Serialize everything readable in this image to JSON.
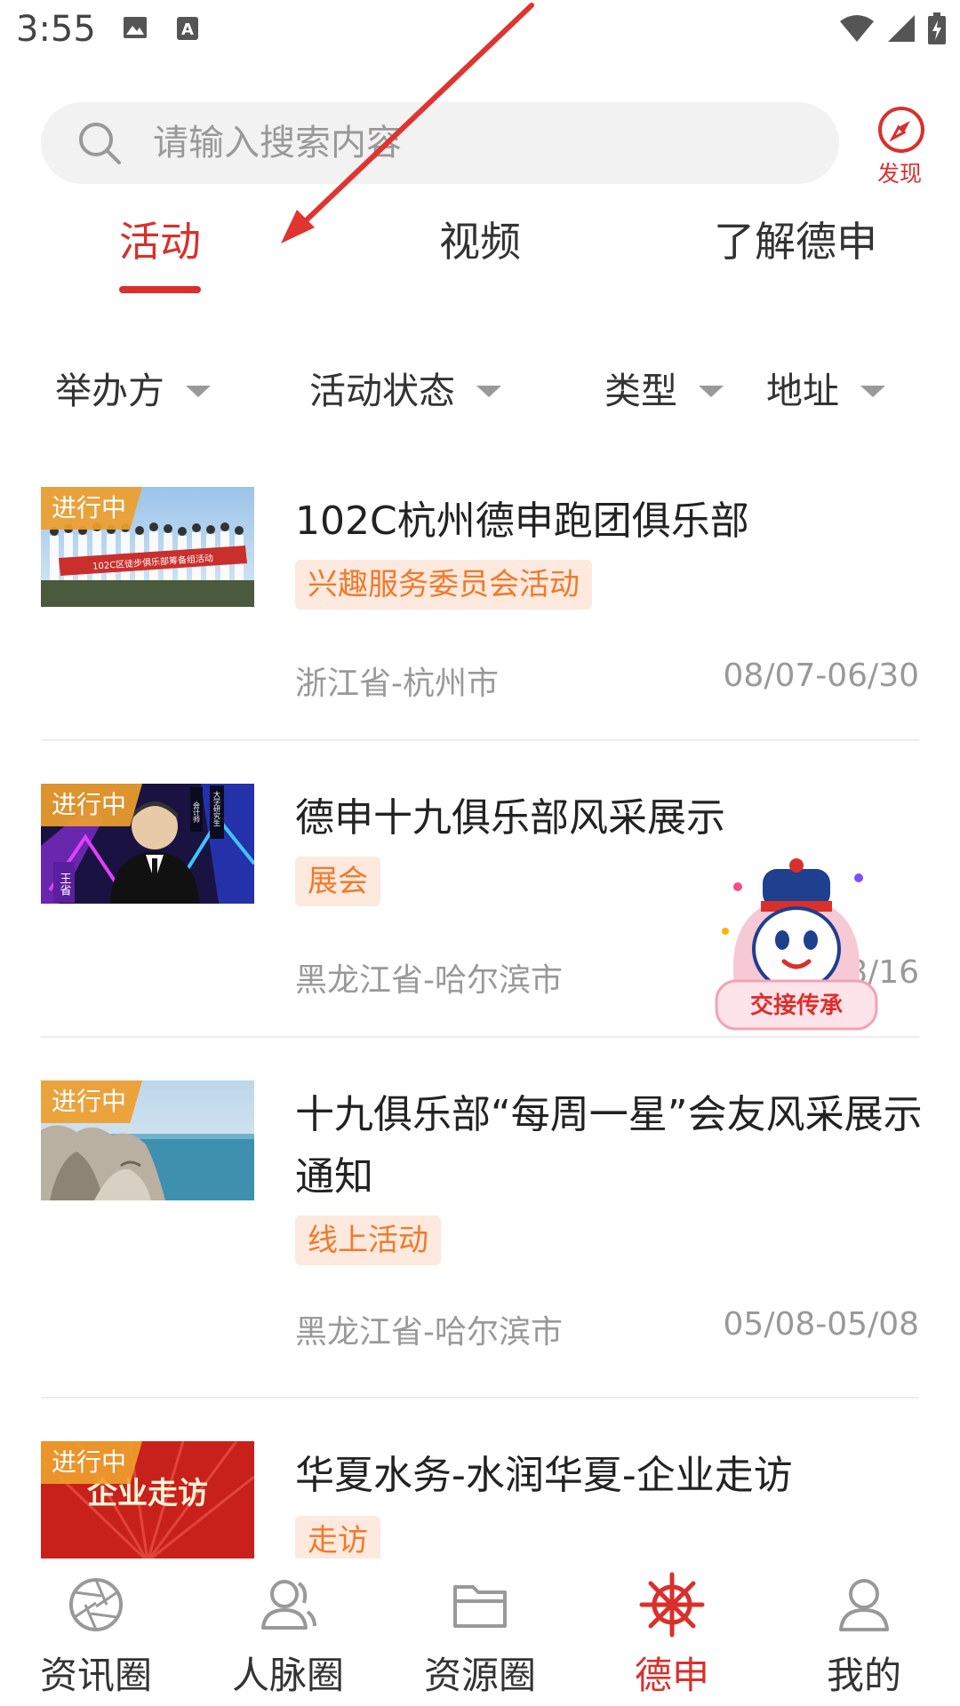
{
  "status_bar": {
    "time": "3:55",
    "left_icons": [
      "image-icon",
      "a-text-icon"
    ],
    "right_icons": [
      "wifi-icon",
      "signal-icon",
      "battery-charging-icon"
    ]
  },
  "search": {
    "placeholder": "请输入搜索内容",
    "discover_label": "发现"
  },
  "tabs": [
    {
      "label": "活动",
      "active": true
    },
    {
      "label": "视频",
      "active": false
    },
    {
      "label": "了解德申",
      "active": false
    }
  ],
  "filters": [
    {
      "label": "举办方"
    },
    {
      "label": "活动状态"
    },
    {
      "label": "类型"
    },
    {
      "label": "地址"
    }
  ],
  "activities": [
    {
      "status": "进行中",
      "title": "102C杭州德申跑团俱乐部",
      "tag": "兴趣服务委员会活动",
      "location": "浙江省-杭州市",
      "date": "08/07-06/30"
    },
    {
      "status": "进行中",
      "title": "德申十九俱乐部风采展示",
      "tag": "展会",
      "location": "黑龙江省-哈尔滨市",
      "date": "08/16"
    },
    {
      "status": "进行中",
      "title": "十九俱乐部“每周一星”会友风采展示通知",
      "tag": "线上活动",
      "location": "黑龙江省-哈尔滨市",
      "date": "05/08-05/08"
    },
    {
      "status": "进行中",
      "title": "华夏水务-水润华夏-企业走访",
      "tag": "走访",
      "thumb_text": "企业走访"
    }
  ],
  "thumbnail_texts": {
    "banner": "102C区徒步俱乐部筹备组活动",
    "person_name": "王省",
    "side_text_1": "会计师",
    "side_text_2": "大学研究生"
  },
  "mascot_label": "交接传承",
  "bottom_nav": [
    {
      "label": "资讯圈",
      "icon": "aperture-icon",
      "active": false
    },
    {
      "label": "人脉圈",
      "icon": "contacts-icon",
      "active": false
    },
    {
      "label": "资源圈",
      "icon": "folder-icon",
      "active": false
    },
    {
      "label": "德申",
      "icon": "ship-wheel-icon",
      "active": true
    },
    {
      "label": "我的",
      "icon": "person-icon",
      "active": false
    }
  ],
  "colors": {
    "accent": "#d9302c",
    "tag_text": "#f07a2c",
    "tag_bg": "#fde9de",
    "badge": "#ee9e2c"
  }
}
